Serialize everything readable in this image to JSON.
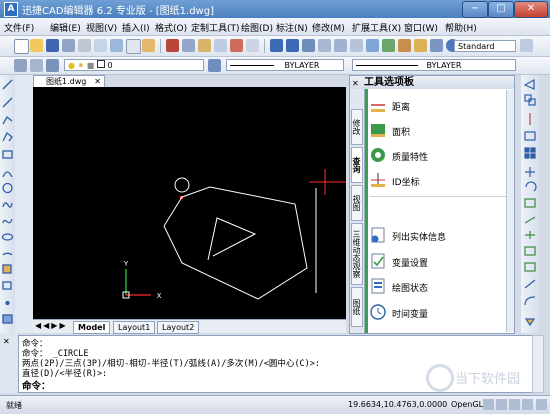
{
  "window": {
    "app_icon": "A",
    "title": "迅捷CAD编辑器 6.2 专业版 - [图纸1.dwg]",
    "controls": [
      "−",
      "□",
      "✕"
    ]
  },
  "menu": [
    "文件(F)",
    "编辑(E)",
    "视图(V)",
    "插入(I)",
    "格式(O)",
    "定制工具(T)",
    "绘图(D)",
    "标注(N)",
    "修改(M)",
    "扩展工具(X)",
    "窗口(W)",
    "帮助(H)"
  ],
  "toolbar": {
    "text_style": "Standard",
    "layer_value": "0",
    "linetype_value": "BYLAYER",
    "lineweight_value": "BYLAYER"
  },
  "document": {
    "tab_label": "图纸1.dwg",
    "layout_tabs": [
      "Model",
      "Layout1",
      "Layout2"
    ],
    "ucs": {
      "x": "X",
      "y": "Y"
    }
  },
  "palette": {
    "title": "工具选项板",
    "tabs": [
      "修改",
      "查询",
      "视图",
      "三维动态观察",
      "图纸"
    ],
    "items": [
      "距离",
      "面积",
      "质量特性",
      "ID坐标",
      "列出实体信息",
      "变量设置",
      "绘图状态",
      "时间变量"
    ]
  },
  "command": {
    "lines": [
      "命令：",
      "命令：  _CIRCLE",
      "两点(2P)/三点(3P)/相切-相切-半径(T)/弧线(A)/多次(M)/<圆中心(C)>:",
      "直径(D)/<半径(R)>:",
      "命令："
    ]
  },
  "status": {
    "ready": "就绪",
    "coords": "19.6634,10.4763,0.0000",
    "renderer": "OpenGL"
  },
  "watermark": "当下软件园",
  "colors": {
    "title_bar": "#5a8bc8",
    "canvas": "#000000",
    "accent": "#2f6fc0"
  }
}
